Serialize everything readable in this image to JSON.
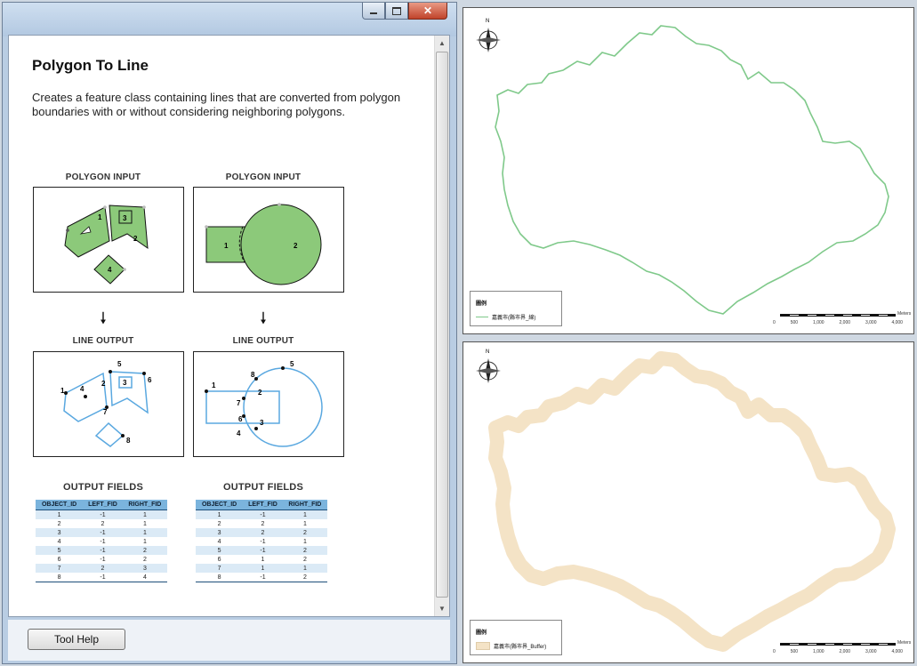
{
  "help_window": {
    "title": "Polygon To Line",
    "description": "Creates a feature class containing lines that are converted from polygon boundaries with or without considering neighboring polygons.",
    "left_input_label": "POLYGON INPUT",
    "right_input_label": "POLYGON INPUT",
    "left_output_label": "LINE OUTPUT",
    "right_output_label": "LINE OUTPUT",
    "left_fields_label": "OUTPUT FIELDS",
    "right_fields_label": "OUTPUT FIELDS",
    "left_input_ids": [
      "1",
      "2",
      "3",
      "4"
    ],
    "right_input_ids": [
      "1",
      "2"
    ],
    "left_output_ids": [
      "1",
      "2",
      "3",
      "4",
      "5",
      "6",
      "7",
      "8"
    ],
    "right_output_ids": [
      "1",
      "2",
      "3",
      "4",
      "5",
      "6",
      "7",
      "8"
    ],
    "table_headers": [
      "OBJECT_ID",
      "LEFT_FID",
      "RIGHT_FID"
    ],
    "left_table": [
      [
        "1",
        "-1",
        "1"
      ],
      [
        "2",
        "2",
        "1"
      ],
      [
        "3",
        "-1",
        "1"
      ],
      [
        "4",
        "-1",
        "1"
      ],
      [
        "5",
        "-1",
        "2"
      ],
      [
        "6",
        "-1",
        "2"
      ],
      [
        "7",
        "2",
        "3"
      ],
      [
        "8",
        "-1",
        "4"
      ]
    ],
    "right_table": [
      [
        "1",
        "-1",
        "1"
      ],
      [
        "2",
        "2",
        "1"
      ],
      [
        "3",
        "2",
        "2"
      ],
      [
        "4",
        "-1",
        "1"
      ],
      [
        "5",
        "-1",
        "2"
      ],
      [
        "6",
        "1",
        "2"
      ],
      [
        "7",
        "1",
        "1"
      ],
      [
        "8",
        "-1",
        "2"
      ]
    ],
    "tool_help_button": "Tool Help",
    "scroll_up": "▲",
    "scroll_down": "▼"
  },
  "map_top": {
    "legend_title": "圖例",
    "legend_item": "嘉義市(縣市界_線)",
    "line_color": "#7fc98a",
    "scale_ticks": [
      "0",
      "500",
      "1,000",
      "2,000",
      "3,000",
      "4,000"
    ],
    "scale_unit": "Meters",
    "north_n": "N"
  },
  "map_bottom": {
    "legend_title": "圖例",
    "legend_item": "嘉義市(縣市界_Buffer)",
    "buffer_color": "#f4e3c6",
    "scale_ticks": [
      "0",
      "500",
      "1,000",
      "2,000",
      "3,000",
      "4,000"
    ],
    "scale_unit": "Meters",
    "north_n": "N"
  }
}
